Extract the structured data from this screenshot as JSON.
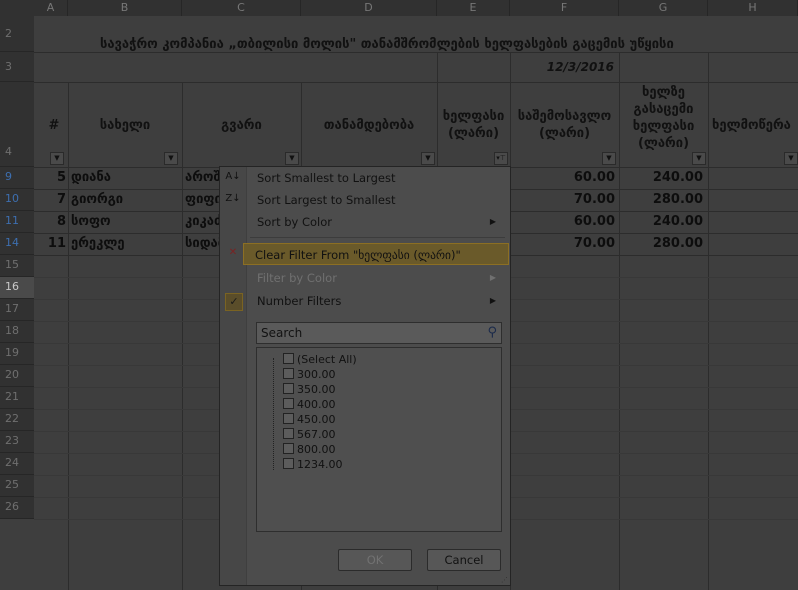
{
  "columns": [
    "A",
    "B",
    "C",
    "D",
    "E",
    "F",
    "G",
    "H"
  ],
  "rows": [
    "2",
    "3",
    "4",
    "9",
    "10",
    "11",
    "14",
    "15",
    "16",
    "17",
    "18",
    "19",
    "20",
    "21",
    "22",
    "23",
    "24",
    "25",
    "26"
  ],
  "title": "სავაჭრო კომპანია „თბილისი მოლის\" თანამშრომლების ხელფასების გაცემის უწყისი",
  "date": "12/3/2016",
  "headers": {
    "num": "#",
    "name": "სახელი",
    "surname": "გვარი",
    "position": "თანამდებობა",
    "salary": [
      "ხელფასი",
      "(ლარი)"
    ],
    "bonus": [
      "საშემოსავლო",
      "(ლარი)"
    ],
    "net": [
      "ხელზე",
      "გასაცემი",
      "ხელფასი",
      "(ლარი)"
    ],
    "sign": "ხელმოწერა"
  },
  "data_rows": [
    {
      "num": "5",
      "name": "დიანა",
      "surname": "აროშ",
      "bonus": "60.00",
      "net": "240.00"
    },
    {
      "num": "7",
      "name": "გიორგი",
      "surname": "ფიფი",
      "bonus": "70.00",
      "net": "280.00"
    },
    {
      "num": "8",
      "name": "სოფო",
      "surname": "კიკაძ",
      "bonus": "60.00",
      "net": "240.00"
    },
    {
      "num": "11",
      "name": "ერეკლე",
      "surname": "სიდამ",
      "bonus": "70.00",
      "net": "280.00"
    }
  ],
  "menu": {
    "sort_asc": "Sort Smallest to Largest",
    "sort_desc": "Sort Largest to Smallest",
    "sort_color": "Sort by Color",
    "clear_filter": "Clear Filter From \"ხელფასი (ლარი)\"",
    "filter_color": "Filter by Color",
    "number_filters": "Number Filters",
    "search_placeholder": "Search",
    "values": [
      "(Select All)",
      "300.00",
      "350.00",
      "400.00",
      "450.00",
      "567.00",
      "800.00",
      "1234.00"
    ],
    "ok": "OK",
    "cancel": "Cancel"
  }
}
